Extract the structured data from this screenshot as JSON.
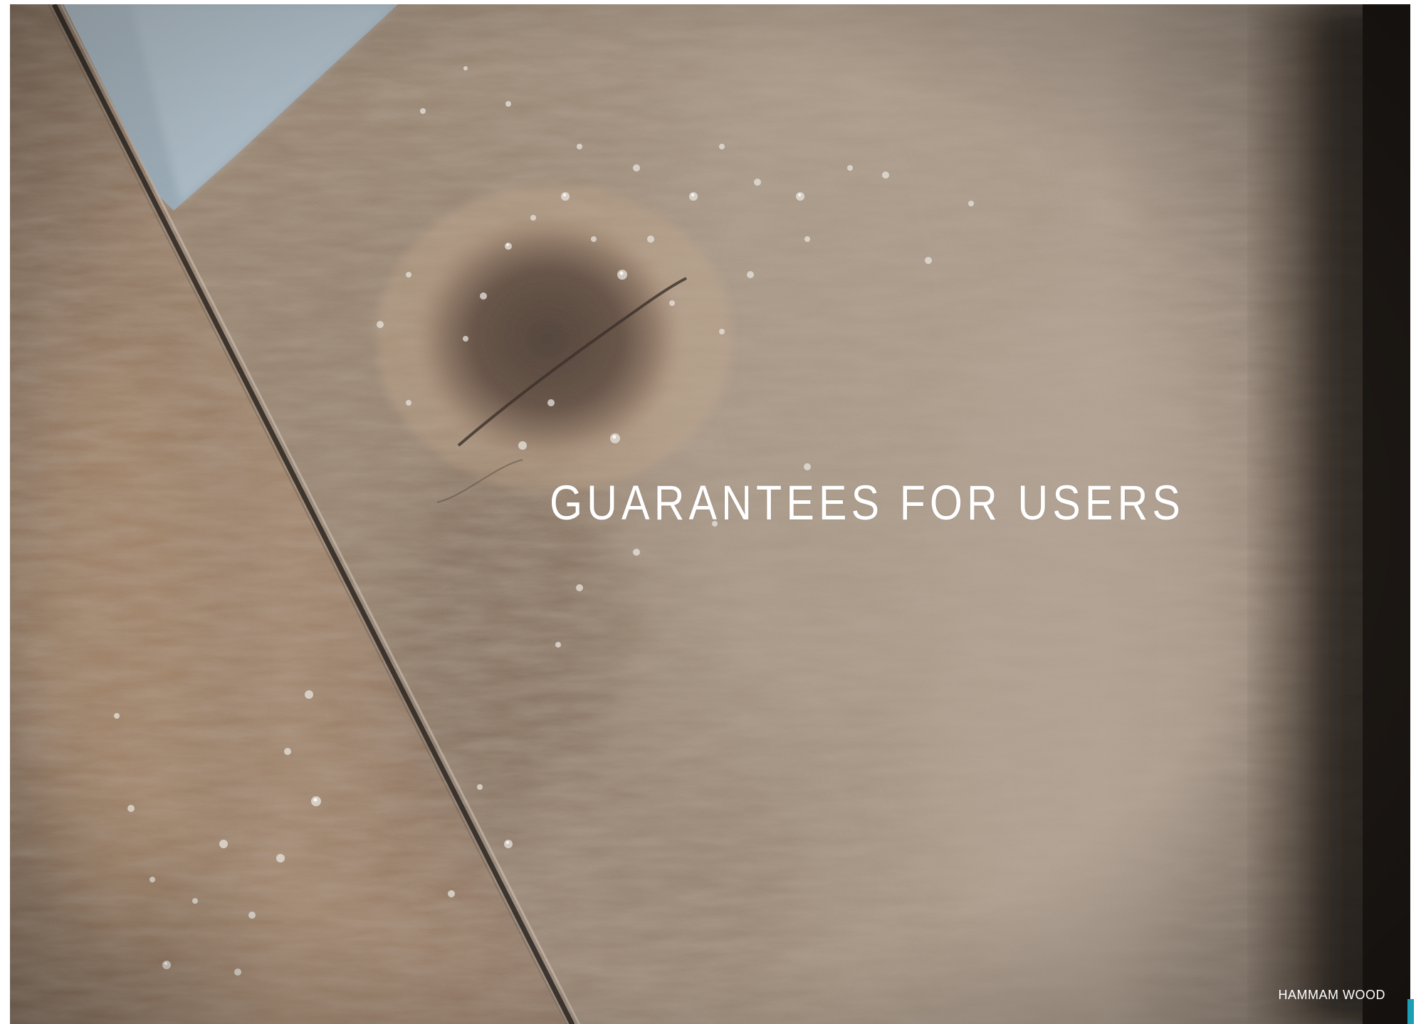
{
  "headline": "GUARANTEES FOR USERS",
  "caption": "HAMMAM WOOD",
  "colors": {
    "text": "#ffffff",
    "accent": "#1a9fb5",
    "wood_light": "#b49a80",
    "wood_dark": "#5a4535",
    "tile_blue": "#9fb4c4"
  }
}
